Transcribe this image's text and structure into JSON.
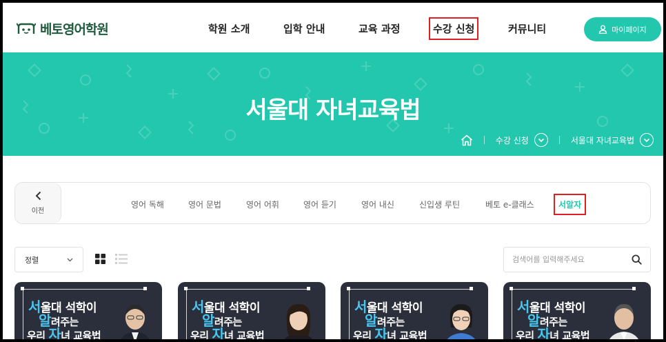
{
  "header": {
    "logo_text": "베토영어학원",
    "nav": [
      "학원 소개",
      "입학 안내",
      "교육 과정",
      "수강 신청",
      "커뮤니티"
    ],
    "mypage_label": "마이페이지"
  },
  "banner": {
    "title": "서울대 자녀교육법",
    "breadcrumb": [
      "수강 신청",
      "서울대 자녀교육법"
    ]
  },
  "categories": {
    "prev_label": "이전",
    "items": [
      "영어 독해",
      "영어 문법",
      "영어 어휘",
      "영어 듣기",
      "영어 내신",
      "신입생 루틴",
      "베토 e-클래스",
      "서알자"
    ],
    "active": "서알자"
  },
  "toolbar": {
    "sort_label": "정렬",
    "search_placeholder": "검색어를 입력해주세요"
  },
  "cards": [
    {
      "line1_hl": "서",
      "line1": "울대 석학이",
      "line2_hl": "알",
      "line2": "려주는",
      "line3_a": "우리 ",
      "line3_hl": "자",
      "line3_b": "녀 교육법"
    },
    {
      "line1_hl": "서",
      "line1": "울대 석학이",
      "line2_hl": "알",
      "line2": "려주는",
      "line3_a": "우리 ",
      "line3_hl": "자",
      "line3_b": "녀 교육법"
    },
    {
      "line1_hl": "서",
      "line1": "울대 석학이",
      "line2_hl": "알",
      "line2": "려주는",
      "line3_a": "우리 ",
      "line3_hl": "자",
      "line3_b": "녀 교육법"
    },
    {
      "line1_hl": "서",
      "line1": "울대 석학이",
      "line2_hl": "알",
      "line2": "려주는",
      "line3_a": "우리 ",
      "line3_hl": "자",
      "line3_b": "녀 교육법"
    }
  ],
  "colors": {
    "accent": "#22c7ad",
    "brand_green": "#1f5a3c",
    "highlight_box": "#e02020",
    "card_bg": "#2b2f3b",
    "card_highlight": "#48c6f0"
  },
  "icons": [
    "logo-mark-icon",
    "user-icon",
    "home-icon",
    "chevron-down-icon",
    "chevron-left-icon",
    "grid-view-icon",
    "list-view-icon",
    "search-icon"
  ]
}
